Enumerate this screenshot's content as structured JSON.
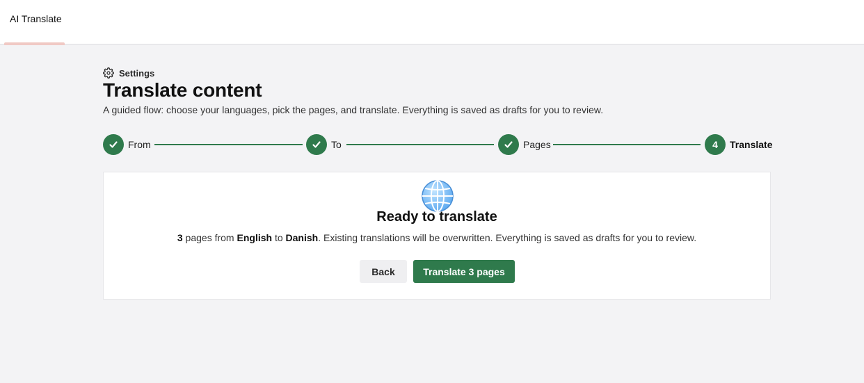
{
  "app": {
    "tab_label": "AI Translate"
  },
  "breadcrumb": {
    "label": "Settings",
    "icon": "gear-icon"
  },
  "page": {
    "title": "Translate content",
    "subtitle": "A guided flow: choose your languages, pick the pages, and translate. Everything is saved as drafts for you to review."
  },
  "stepper": {
    "steps": [
      {
        "label": "From",
        "status": "complete"
      },
      {
        "label": "To",
        "status": "complete"
      },
      {
        "label": "Pages",
        "status": "complete"
      },
      {
        "label": "Translate",
        "status": "current",
        "number": "4"
      }
    ],
    "accent_color": "#2f7a4c"
  },
  "card": {
    "icon": "globe-icon",
    "title": "Ready to translate",
    "page_count": "3",
    "text_pages_from": " pages from ",
    "source_language": "English",
    "text_to": " to ",
    "target_language": "Danish",
    "text_rest": ". Existing translations will be overwritten. Everything is saved as drafts for you to review.",
    "back_label": "Back",
    "primary_label": "Translate 3 pages"
  }
}
